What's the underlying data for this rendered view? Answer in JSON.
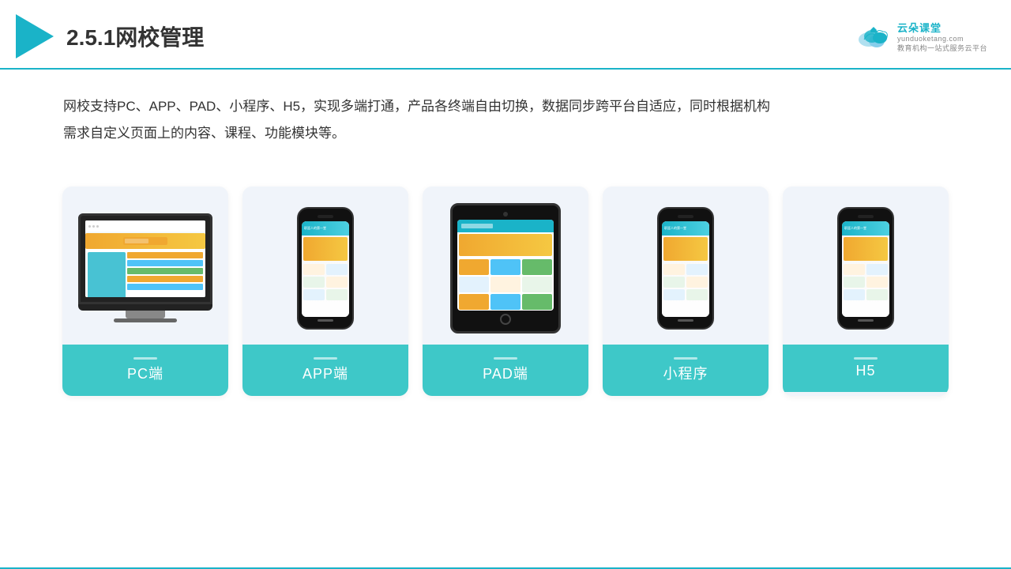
{
  "header": {
    "title": "2.5.1网校管理",
    "brand_name": "云朵课堂",
    "brand_url": "yunduoketang.com",
    "brand_tagline": "教育机构一站式服务云平台"
  },
  "description": {
    "text": "网校支持PC、APP、PAD、小程序、H5，实现多端打通，产品各终端自由切换，数据同步跨平台自适应，同时根据机构需求自定义页面上的内容、课程、功能模块等。"
  },
  "cards": [
    {
      "id": "pc",
      "label": "PC端"
    },
    {
      "id": "app",
      "label": "APP端"
    },
    {
      "id": "pad",
      "label": "PAD端"
    },
    {
      "id": "mini",
      "label": "小程序"
    },
    {
      "id": "h5",
      "label": "H5"
    }
  ],
  "colors": {
    "teal": "#3ec8c8",
    "teal_dark": "#1ab3c8",
    "accent_orange": "#f0a830"
  }
}
